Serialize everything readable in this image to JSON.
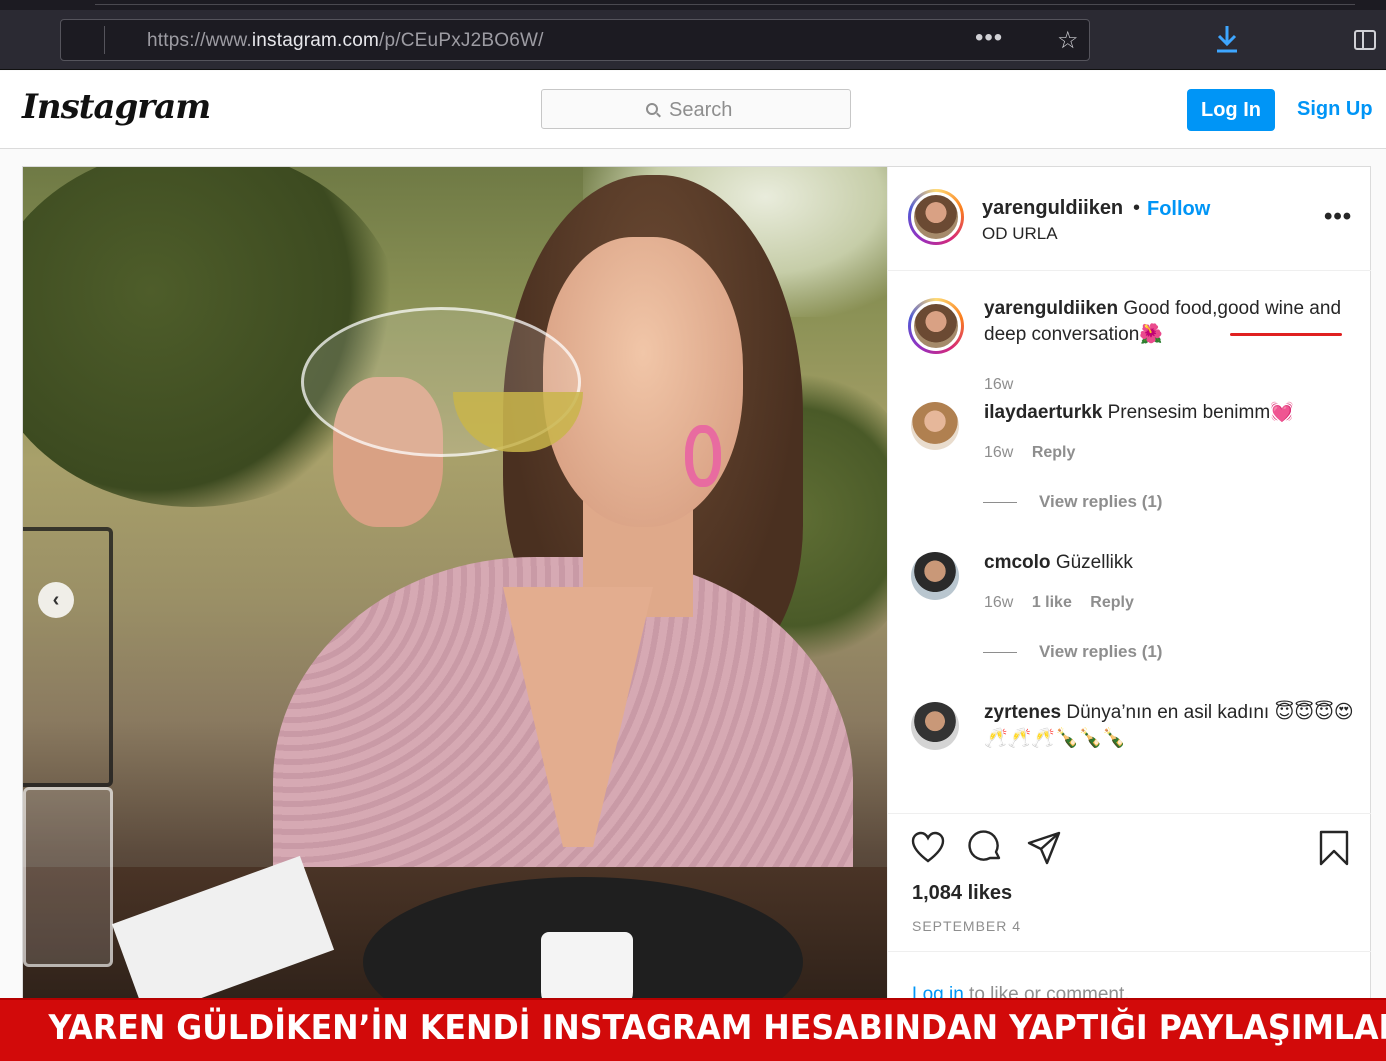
{
  "browser": {
    "url_prefix": "https://www.",
    "url_host": "instagram.com",
    "url_path": "/p/CEuPxJ2BO6W/",
    "menu_icon": "ellipsis-icon",
    "bookmark_icon": "star-icon",
    "download_icon": "download-icon",
    "sidebar_icon": "sidebar-icon"
  },
  "header": {
    "logo": "Instagram",
    "search_placeholder": "Search",
    "login_label": "Log In",
    "signup_label": "Sign Up",
    "accent_color": "#0095f6"
  },
  "post": {
    "username": "yarenguldiiken",
    "dot": "•",
    "follow_label": "Follow",
    "location": "OD URLA",
    "more_icon": "more-options-icon",
    "prev_icon": "chevron-left-icon",
    "caption": {
      "username": "yarenguldiiken",
      "text": "Good food,good wine and deep conversation🌺",
      "time": "16w"
    },
    "comments": [
      {
        "username": "ilaydaerturkk",
        "text": "Prensesim benimm💓",
        "time": "16w",
        "likes": "",
        "reply_label": "Reply",
        "view_replies": "View replies (1)"
      },
      {
        "username": "cmcolo",
        "text": "Güzellikk",
        "time": "16w",
        "likes": "1 like",
        "reply_label": "Reply",
        "view_replies": "View replies (1)"
      },
      {
        "username": "zyrtenes",
        "text": "Dünya’nın en asil kadını 😇😇😇😍🥂🥂🥂🍾🍾🍾"
      }
    ],
    "likes": "1,084 likes",
    "date": "SEPTEMBER 4",
    "login_prompt_link": "Log in",
    "login_prompt_rest": " to like or comment."
  },
  "banner": {
    "text": "YAREN GÜLDİKEN’İN KENDİ INSTAGRAM HESABINDAN YAPTIĞI PAYLAŞIMLAR",
    "color": "#d20a0a"
  }
}
